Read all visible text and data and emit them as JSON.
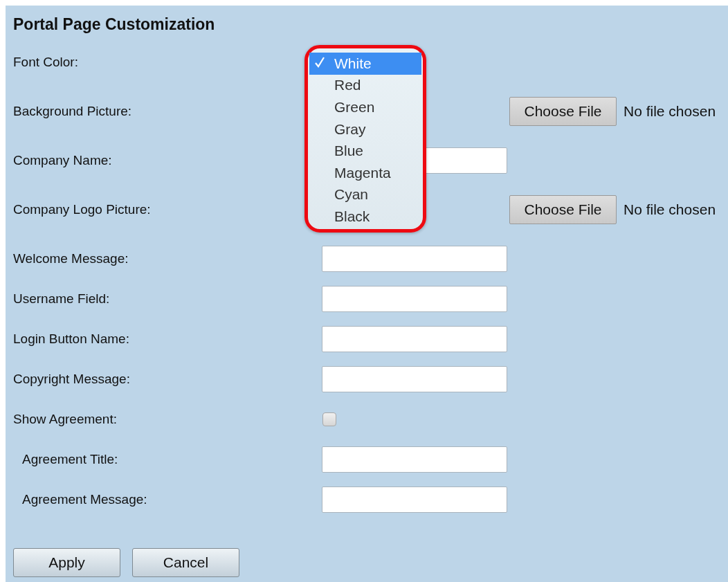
{
  "title": "Portal Page Customization",
  "fields": [
    {
      "kind": "select",
      "label": "Font Color:"
    },
    {
      "kind": "file",
      "label": "Background Picture:",
      "button": "Choose File",
      "status": "No file chosen"
    },
    {
      "kind": "text",
      "label": "Company Name:"
    },
    {
      "kind": "file",
      "label": "Company Logo Picture:",
      "button": "Choose File",
      "status": "No file chosen"
    },
    {
      "kind": "text",
      "label": "Welcome Message:"
    },
    {
      "kind": "text",
      "label": "Username Field:"
    },
    {
      "kind": "text",
      "label": "Login Button Name:"
    },
    {
      "kind": "text",
      "label": "Copyright Message:"
    },
    {
      "kind": "checkbox",
      "label": "Show Agreement:",
      "checked": false,
      "children": [
        {
          "kind": "text",
          "label": "Agreement Title:"
        },
        {
          "kind": "text",
          "label": "Agreement Message:"
        }
      ]
    }
  ],
  "font_color_dropdown": {
    "options": [
      {
        "label": "White",
        "selected": true
      },
      {
        "label": "Red",
        "selected": false
      },
      {
        "label": "Green",
        "selected": false
      },
      {
        "label": "Gray",
        "selected": false
      },
      {
        "label": "Blue",
        "selected": false
      },
      {
        "label": "Magenta",
        "selected": false
      },
      {
        "label": "Cyan",
        "selected": false
      },
      {
        "label": "Black",
        "selected": false
      }
    ]
  },
  "buttons": [
    "Apply",
    "Cancel"
  ]
}
